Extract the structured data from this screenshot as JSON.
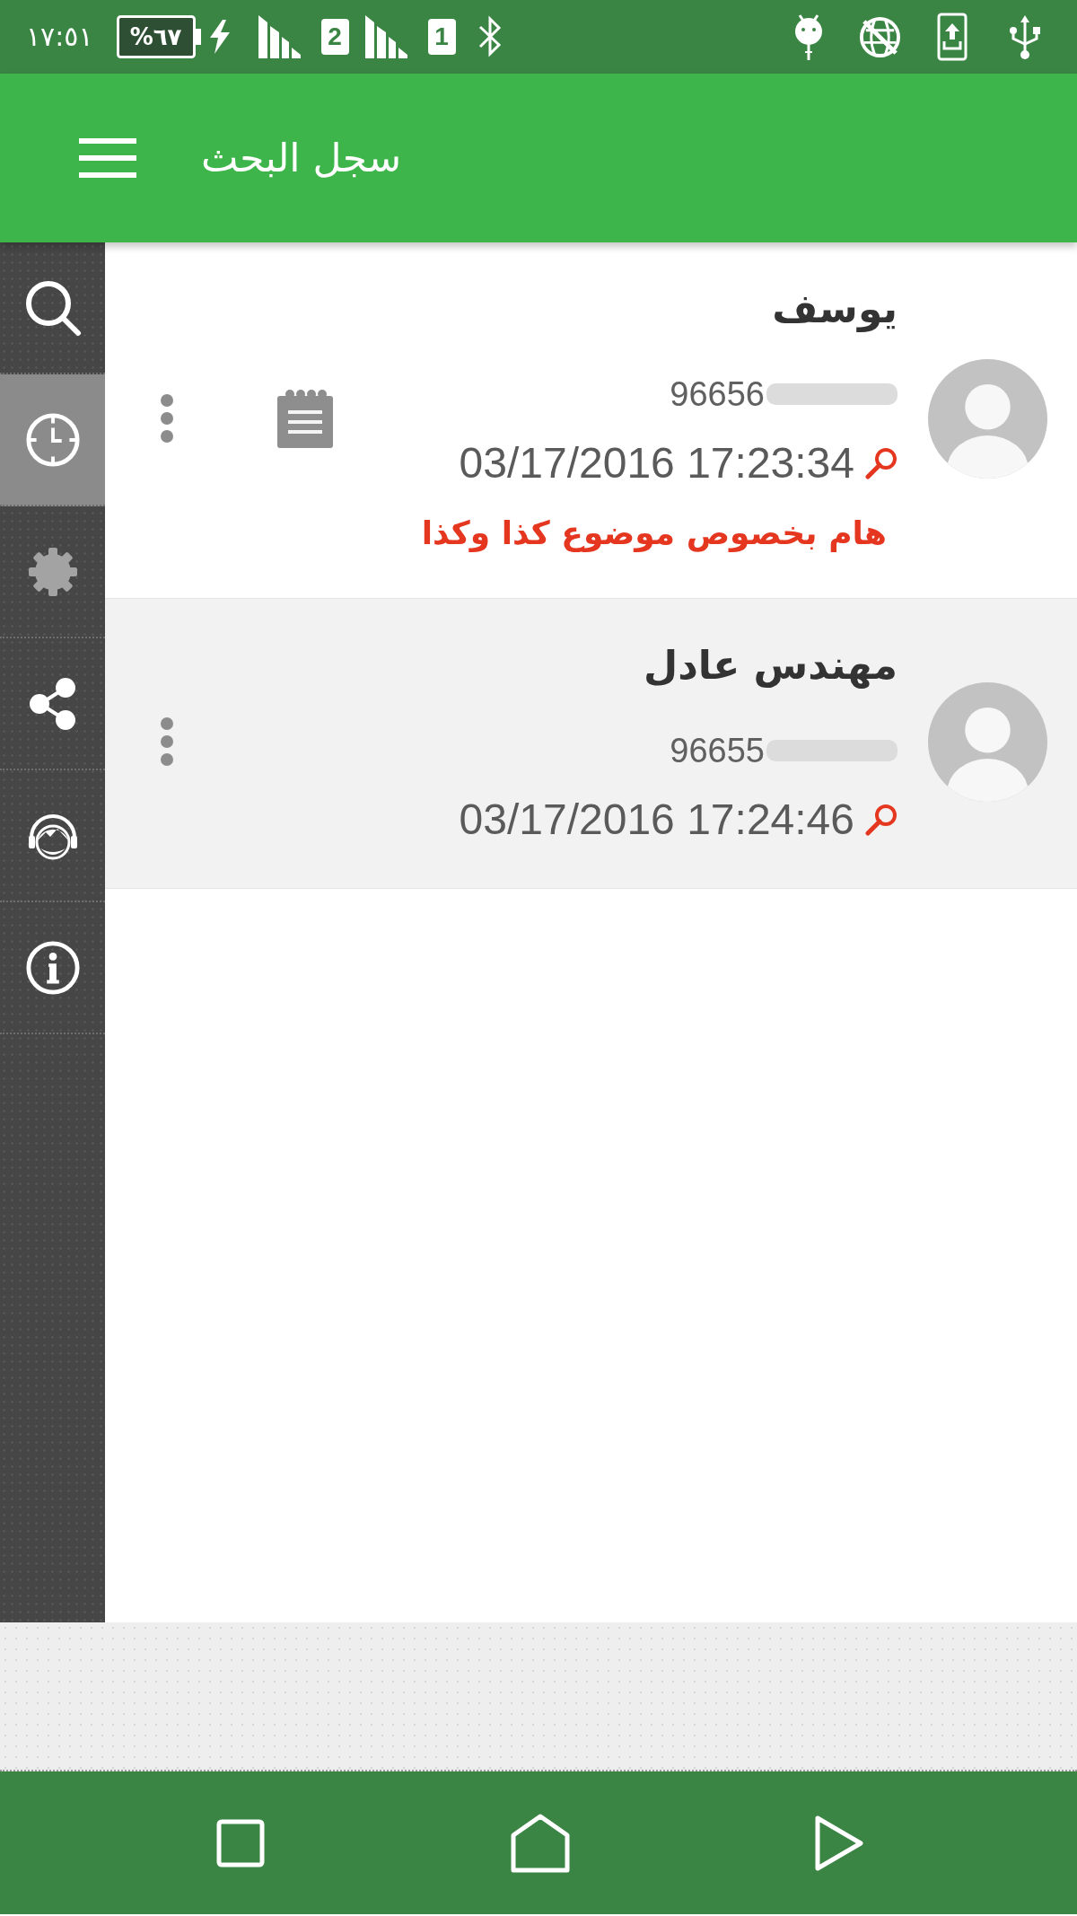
{
  "status_bar": {
    "time": "١٧:٥١",
    "battery": "%٦٧",
    "sims": [
      "1",
      "2"
    ]
  },
  "app_bar": {
    "title": "سجل البحث"
  },
  "sidebar": {
    "items": [
      {
        "kind": "search",
        "selected": false,
        "disabled": false
      },
      {
        "kind": "history",
        "selected": true,
        "disabled": false
      },
      {
        "kind": "settings",
        "selected": false,
        "disabled": true
      },
      {
        "kind": "share",
        "selected": false,
        "disabled": false
      },
      {
        "kind": "support",
        "selected": false,
        "disabled": false
      },
      {
        "kind": "info",
        "selected": false,
        "disabled": false
      }
    ]
  },
  "history": [
    {
      "name": "يوسف",
      "phone": "96656",
      "time": "03/17/2016 17:23:34",
      "note": "هام بخصوص موضوع كذا وكذا",
      "highlighted": false
    },
    {
      "name": "مهندس عادل",
      "phone": "96655",
      "time": "03/17/2016 17:24:46",
      "highlighted": true
    }
  ]
}
